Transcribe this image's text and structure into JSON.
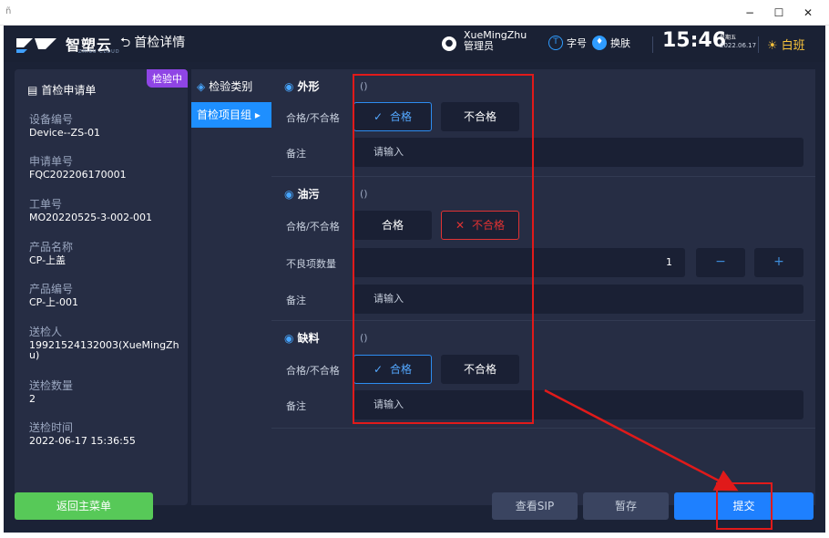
{
  "window": {
    "minimize_glyph": "−",
    "maximize_glyph": "☐",
    "close_glyph": "✕"
  },
  "header": {
    "brand": "智塑云",
    "brand_sub": "ZHISU CLOUD",
    "back_label": "首检详情",
    "user_name": "XueMingZhu",
    "user_role": "管理员",
    "font_size_label": "字号",
    "skin_label": "换肤",
    "time": "15:46",
    "weekday": "星期五",
    "date": "2022.06.17",
    "shift": "白班"
  },
  "info": {
    "status_badge": "检验中",
    "title": "首检申请单",
    "fields": [
      {
        "label": "设备编号",
        "value": "Device--ZS-01"
      },
      {
        "label": "申请单号",
        "value": "FQC202206170001"
      },
      {
        "label": "工单号",
        "value": "MO20220525-3-002-001"
      },
      {
        "label": "产品名称",
        "value": "CP-上盖"
      },
      {
        "label": "产品编号",
        "value": "CP-上-001"
      },
      {
        "label": "送检人",
        "value": "19921524132003(XueMingZhu)"
      },
      {
        "label": "送检数量",
        "value": "2"
      },
      {
        "label": "送检时间",
        "value": "2022-06-17 15:36:55"
      }
    ]
  },
  "tabs": {
    "category": "检验类别",
    "group": "首检项目组 ▸"
  },
  "sections": [
    {
      "title": "外形",
      "paren": "()",
      "pass_label": "合格/不合格",
      "ok": "合格",
      "ng": "不合格",
      "selected": "ok",
      "remark_label": "备注",
      "remark_placeholder": "请输入"
    },
    {
      "title": "油污",
      "paren": "()",
      "pass_label": "合格/不合格",
      "ok": "合格",
      "ng": "不合格",
      "selected": "ng",
      "defect_label": "不良项数量",
      "defect_value": "1",
      "minus": "−",
      "plus": "+",
      "remark_label": "备注",
      "remark_placeholder": "请输入"
    },
    {
      "title": "缺料",
      "paren": "()",
      "pass_label": "合格/不合格",
      "ok": "合格",
      "ng": "不合格",
      "selected": "ok",
      "remark_label": "备注",
      "remark_placeholder": "请输入"
    }
  ],
  "footer": {
    "home": "返回主菜单",
    "sip": "查看SIP",
    "save": "暂存",
    "submit": "提交"
  },
  "colors": {
    "accent": "#1e80ff",
    "ok": "#2d8cf0",
    "ng": "#e03232",
    "home": "#57c958",
    "badge": "#8f45e5",
    "annotation": "#e01a1a"
  },
  "icons": [
    "layers-icon",
    "doc-icon",
    "section-icon",
    "check-icon",
    "cross-icon",
    "user-icon",
    "font-size-icon",
    "skin-icon",
    "sun-icon",
    "back-arrow-icon"
  ]
}
